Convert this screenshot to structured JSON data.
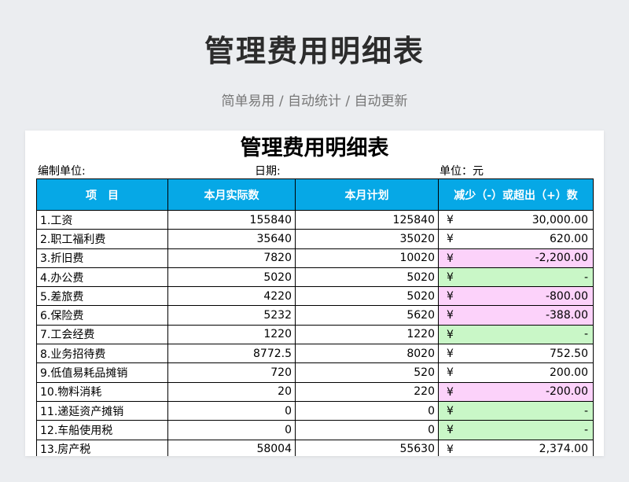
{
  "header": {
    "title": "管理费用明细表",
    "tagline": "简单易用 / 自动统计 / 自动更新"
  },
  "sheet": {
    "title": "管理费用明细表",
    "unit_label": "编制单位:",
    "date_label": "日期:",
    "currency_label": "单位：元",
    "columns": [
      "项　目",
      "本月实际数",
      "本月计划",
      "减少（-）或超出（+）数"
    ],
    "currency_symbol": "¥",
    "colors": {
      "header": "#06a8e6",
      "negative": "#fcd2fa",
      "zero": "#c9f7c7"
    },
    "rows": [
      {
        "item": "1.工资",
        "actual": "155840",
        "plan": "125840",
        "diff": "30,000.00",
        "status": "pos"
      },
      {
        "item": "2.职工福利费",
        "actual": "35640",
        "plan": "35020",
        "diff": "620.00",
        "status": "pos"
      },
      {
        "item": "3.折旧费",
        "actual": "7820",
        "plan": "10020",
        "diff": "-2,200.00",
        "status": "neg"
      },
      {
        "item": "4.办公费",
        "actual": "5020",
        "plan": "5020",
        "diff": "-",
        "status": "zero"
      },
      {
        "item": "5.差旅费",
        "actual": "4220",
        "plan": "5020",
        "diff": "-800.00",
        "status": "neg"
      },
      {
        "item": "6.保险费",
        "actual": "5232",
        "plan": "5620",
        "diff": "-388.00",
        "status": "neg"
      },
      {
        "item": "7.工会经费",
        "actual": "1220",
        "plan": "1220",
        "diff": "-",
        "status": "zero"
      },
      {
        "item": "8.业务招待费",
        "actual": "8772.5",
        "plan": "8020",
        "diff": "752.50",
        "status": "pos"
      },
      {
        "item": "9.低值易耗品摊销",
        "actual": "720",
        "plan": "520",
        "diff": "200.00",
        "status": "pos"
      },
      {
        "item": "10.物料消耗",
        "actual": "20",
        "plan": "220",
        "diff": "-200.00",
        "status": "neg"
      },
      {
        "item": "11.递延资产摊销",
        "actual": "0",
        "plan": "0",
        "diff": "-",
        "status": "zero"
      },
      {
        "item": "12.车船使用税",
        "actual": "0",
        "plan": "0",
        "diff": "-",
        "status": "zero"
      },
      {
        "item": "13.房产税",
        "actual": "58004",
        "plan": "55630",
        "diff": "2,374.00",
        "status": "pos"
      }
    ]
  }
}
